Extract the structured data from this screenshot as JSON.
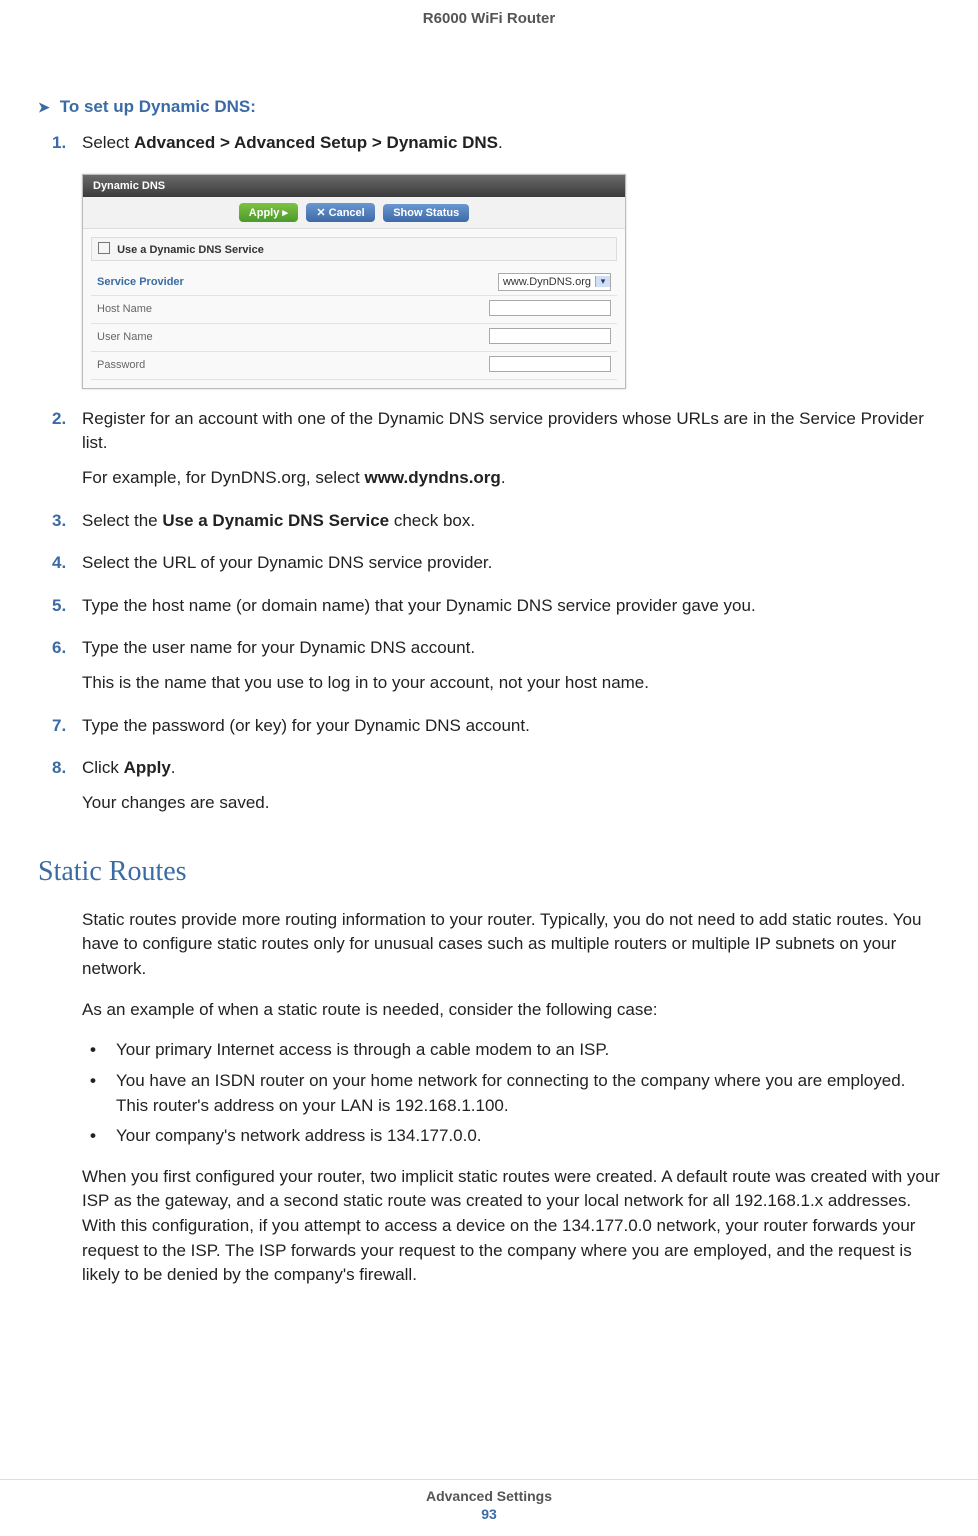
{
  "header": {
    "product": "R6000 WiFi Router"
  },
  "lead": {
    "title": "To set up Dynamic DNS:"
  },
  "steps": [
    {
      "n": "1.",
      "t1": "Select ",
      "b1": "Advanced > Advanced Setup > Dynamic DNS",
      "t2": "."
    },
    {
      "n": "2.",
      "t1": "Register for an account with one of the Dynamic DNS service providers whose URLs are in the Service Provider list.",
      "sub_pre": "For example, for DynDNS.org, select ",
      "sub_b": "www.dyndns.org",
      "sub_post": "."
    },
    {
      "n": "3.",
      "t1": "Select the ",
      "b1": "Use a Dynamic DNS Service",
      "t2": " check box."
    },
    {
      "n": "4.",
      "t1": "Select the URL of your Dynamic DNS service provider."
    },
    {
      "n": "5.",
      "t1": "Type the host name (or domain name) that your Dynamic DNS service provider gave you."
    },
    {
      "n": "6.",
      "t1": "Type the user name for your Dynamic DNS account.",
      "sub": "This is the name that you use to log in to your account, not your host name."
    },
    {
      "n": "7.",
      "t1": "Type the password (or key) for your Dynamic DNS account."
    },
    {
      "n": "8.",
      "t1": "Click ",
      "b1": "Apply",
      "t2": ".",
      "sub": "Your changes are saved."
    }
  ],
  "shot": {
    "title": "Dynamic DNS",
    "apply": "Apply ▸",
    "cancel": "✕ Cancel",
    "status": "Show Status",
    "checkbox": "Use a Dynamic DNS Service",
    "rows": {
      "sp": "Service Provider",
      "hn": "Host Name",
      "un": "User Name",
      "pw": "Password"
    },
    "select_value": "www.DynDNS.org"
  },
  "section2": {
    "title": "Static Routes",
    "p1": "Static routes provide more routing information to your router. Typically, you do not need to add static routes. You have to configure static routes only for unusual cases such as multiple routers or multiple IP subnets on your network.",
    "p2": "As an example of when a static route is needed, consider the following case:",
    "bullets": [
      "Your primary Internet access is through a cable modem to an ISP.",
      "You have an ISDN router on your home network for connecting to the company where you are employed. This router's address on your LAN is 192.168.1.100.",
      "Your company's network address is 134.177.0.0."
    ],
    "p3": "When you first configured your router, two implicit static routes were created. A default route was created with your ISP as the gateway, and a second static route was created to your local network for all 192.168.1.x addresses. With this configuration, if you attempt to access a device on the 134.177.0.0 network, your router forwards your request to the ISP. The ISP forwards your request to the company where you are employed, and the request is likely to be denied by the company's firewall."
  },
  "footer": {
    "section": "Advanced Settings",
    "page": "93"
  }
}
